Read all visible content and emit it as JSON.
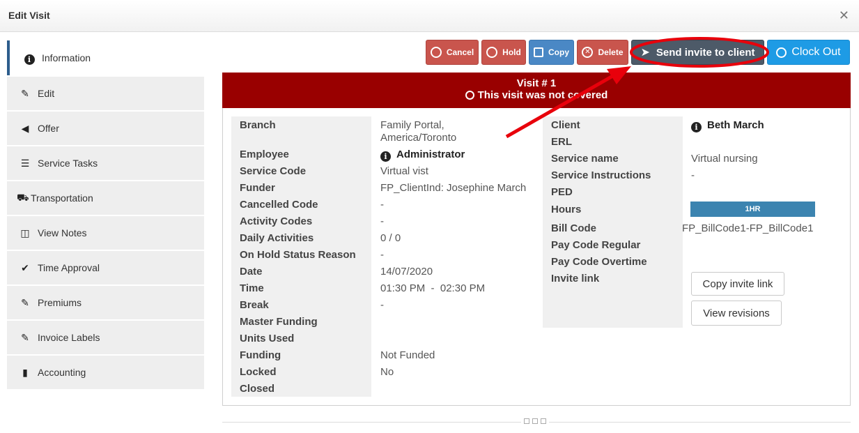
{
  "window": {
    "title": "Edit Visit"
  },
  "sidebar": {
    "items": [
      {
        "label": "Information",
        "icon": "info-icon"
      },
      {
        "label": "Edit",
        "icon": "pencil-icon"
      },
      {
        "label": "Offer",
        "icon": "megaphone-icon"
      },
      {
        "label": "Service Tasks",
        "icon": "checklist-icon"
      },
      {
        "label": "Transportation",
        "icon": "car-icon"
      },
      {
        "label": "View Notes",
        "icon": "book-icon"
      },
      {
        "label": "Time Approval",
        "icon": "checkmark-icon"
      },
      {
        "label": "Premiums",
        "icon": "pencil-icon"
      },
      {
        "label": "Invoice Labels",
        "icon": "pencil-icon"
      },
      {
        "label": "Accounting",
        "icon": "bar-chart-icon"
      }
    ]
  },
  "toolbar": {
    "cancel": "Cancel",
    "hold": "Hold",
    "copy": "Copy",
    "delete": "Delete",
    "send_invite": "Send invite to client",
    "clock_out": "Clock Out"
  },
  "banner": {
    "line1": "Visit # 1",
    "line2": "This visit was not covered"
  },
  "left_fields": [
    {
      "label": "Branch",
      "value": "Family Portal,\nAmerica/Toronto"
    },
    {
      "label": "Employee",
      "value": "Administrator"
    },
    {
      "label": "Service Code",
      "value": "Virtual vist"
    },
    {
      "label": "Funder",
      "value": "FP_ClientInd: Josephine March"
    },
    {
      "label": "Cancelled Code",
      "value": "-"
    },
    {
      "label": "Activity Codes",
      "value": "-"
    },
    {
      "label": "Daily Activities",
      "value": "0 / 0"
    },
    {
      "label": "On Hold Status Reason",
      "value": "-"
    },
    {
      "label": "Date",
      "value": "14/07/2020"
    },
    {
      "label": "Time",
      "value": "01:30 PM  -  02:30 PM"
    },
    {
      "label": "Break",
      "value": "-"
    },
    {
      "label": "Master Funding",
      "value": ""
    },
    {
      "label": "Units Used",
      "value": ""
    },
    {
      "label": "Funding",
      "value": "Not Funded"
    },
    {
      "label": "Locked",
      "value": "No"
    },
    {
      "label": "Closed",
      "value": ""
    }
  ],
  "right_fields": [
    {
      "label": "Client",
      "value": "Beth March"
    },
    {
      "label": "ERL",
      "value": ""
    },
    {
      "label": "Service name",
      "value": "Virtual nursing"
    },
    {
      "label": "Service Instructions",
      "value": "-"
    },
    {
      "label": "PED",
      "value": ""
    },
    {
      "label": "Hours",
      "value": "1HR"
    },
    {
      "label": "Bill Code",
      "value": "FP_BillCode1-FP_BillCode1"
    },
    {
      "label": "Pay Code Regular",
      "value": ""
    },
    {
      "label": "Pay Code Overtime",
      "value": ""
    },
    {
      "label": "Invite link",
      "value": ""
    }
  ],
  "actions": {
    "copy_invite_link": "Copy invite link",
    "view_revisions": "View revisions"
  },
  "colors": {
    "banner": "#990000",
    "danger_button": "#c9554d",
    "copy_button": "#4a88c5",
    "send_button": "#4d5a68",
    "clock_button": "#1e9be5",
    "hours_badge": "#3c84b0",
    "annotation": "#e8000b"
  }
}
